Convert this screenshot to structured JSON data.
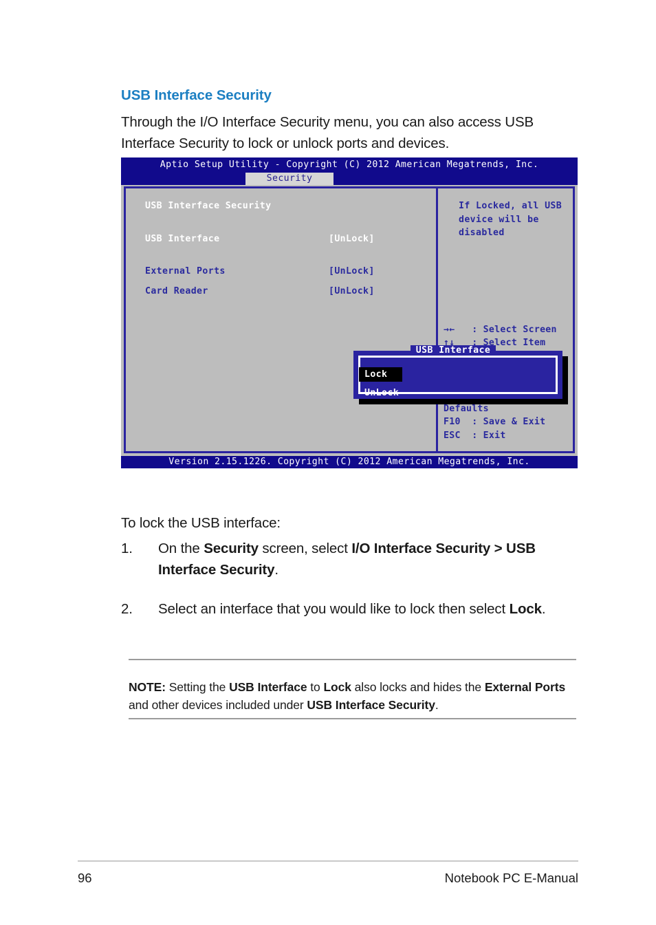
{
  "document": {
    "heading": "USB Interface Security",
    "heading_color": "#1c7fc2",
    "intro": "Through the I/O Interface Security menu, you can also access USB Interface Security to lock or unlock ports and devices.",
    "lead_line": "To lock the USB interface:"
  },
  "bios": {
    "title_bar": "Aptio Setup Utility - Copyright (C) 2012 American Megatrends, Inc.",
    "active_tab": "Security",
    "panel_heading": "USB Interface Security",
    "rows": [
      {
        "label": "USB Interface",
        "value": "[UnLock]",
        "state": "active"
      },
      {
        "label": "External Ports",
        "value": "[UnLock]",
        "state": "normal"
      },
      {
        "label": "Card Reader",
        "value": "[UnLock]",
        "state": "normal"
      }
    ],
    "help_description": "If Locked, all USB device will be disabled",
    "help_keys": "→←   : Select Screen\n↑↓   : Select Item\nEnter: Select\n+/−  : Change Opt.\nF1   : General Help\nF9   : Optimized\nDefaults\nF10  : Save & Exit\nESC  : Exit",
    "footer_bar": "Version 2.15.1226. Copyright (C) 2012 American Megatrends, Inc.",
    "popup": {
      "title": "USB Interface",
      "options": [
        {
          "label": "Lock",
          "selected": true
        },
        {
          "label": "UnLock",
          "selected": false
        }
      ]
    },
    "colors": {
      "title_bar_bg": "#110a8c",
      "body_bg": "#bdbdbd",
      "frame_border": "#2a23a0",
      "text_blue": "#2a2a9e",
      "tab_bg": "#d6d6d6"
    }
  },
  "steps": [
    {
      "number": "1.",
      "parts": [
        {
          "t": "On the ",
          "b": false
        },
        {
          "t": "Security",
          "b": true
        },
        {
          "t": " screen, select ",
          "b": false
        },
        {
          "t": "I/O Interface Security > USB Interface Security",
          "b": true
        },
        {
          "t": ".",
          "b": false
        }
      ]
    },
    {
      "number": "2.",
      "parts": [
        {
          "t": "Select an interface that you would like to lock then select ",
          "b": false
        },
        {
          "t": "Lock",
          "b": true
        },
        {
          "t": ".",
          "b": false
        }
      ]
    }
  ],
  "note": {
    "parts": [
      {
        "t": "NOTE:",
        "b": true
      },
      {
        "t": " Setting the ",
        "b": false
      },
      {
        "t": "USB Interface",
        "b": true
      },
      {
        "t": " to ",
        "b": false
      },
      {
        "t": "Lock",
        "b": true
      },
      {
        "t": " also locks and hides the ",
        "b": false
      },
      {
        "t": "External Ports",
        "b": true
      },
      {
        "t": " and other devices included under ",
        "b": false
      },
      {
        "t": "USB Interface Security",
        "b": true
      },
      {
        "t": ".",
        "b": false
      }
    ]
  },
  "footer": {
    "page_number": "96",
    "manual_title": "Notebook PC E-Manual"
  }
}
